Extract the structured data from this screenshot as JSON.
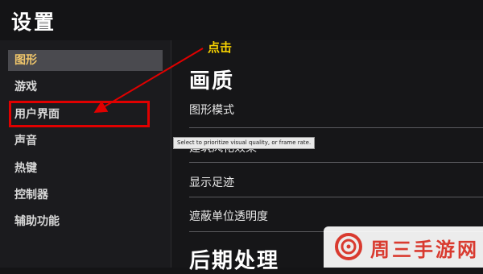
{
  "window": {
    "title": "设置"
  },
  "sidebar": {
    "items": [
      {
        "label": "图形",
        "active": true
      },
      {
        "label": "游戏"
      },
      {
        "label": "用户界面"
      },
      {
        "label": "声音"
      },
      {
        "label": "热键"
      },
      {
        "label": "控制器"
      },
      {
        "label": "辅助功能"
      }
    ]
  },
  "main": {
    "section1": "画质",
    "rows": [
      "图形模式",
      "建筑风化效果",
      "显示足迹",
      "遮蔽单位透明度"
    ],
    "section2": "后期处理",
    "tooltip": "Select to prioritize visual quality, or frame rate."
  },
  "annotation": {
    "label": "点击",
    "color": "#e00000"
  },
  "watermark": {
    "text": "周三手游网"
  },
  "colors": {
    "accent": "#d9a43a",
    "active_text": "#f0c66b",
    "annotation_text": "#f5d000"
  }
}
